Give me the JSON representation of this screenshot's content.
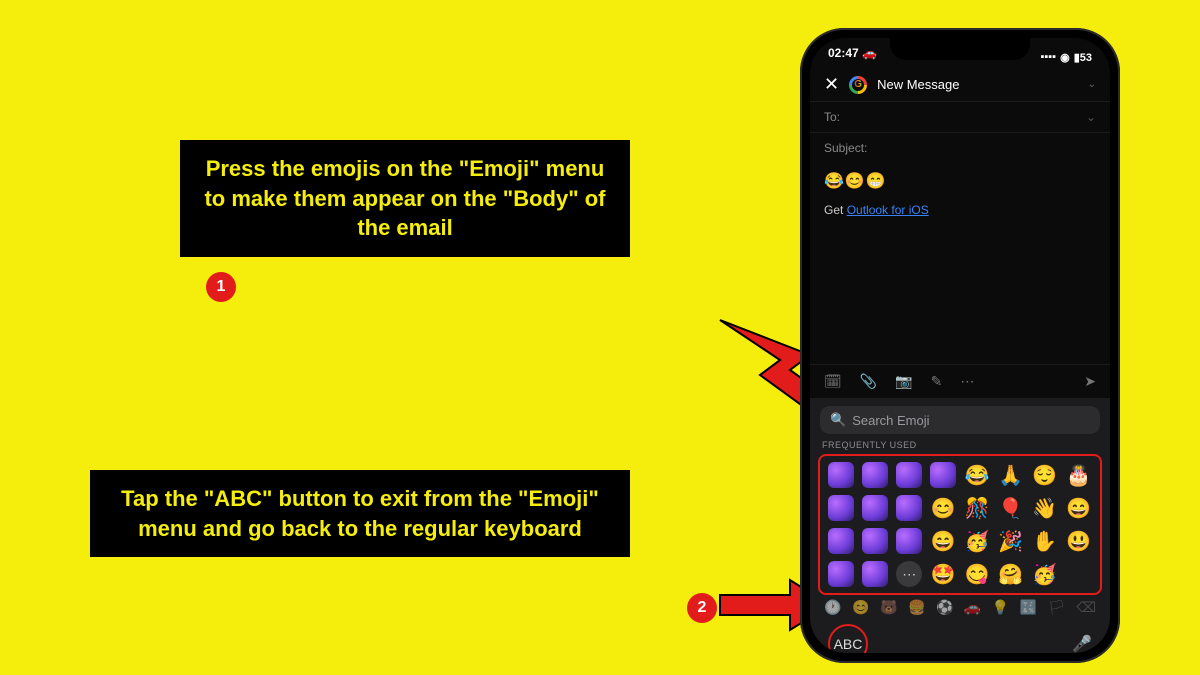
{
  "callouts": {
    "one": "Press the emojis on the \"Emoji\" menu to make them appear on the \"Body\" of the email",
    "two": "Tap the \"ABC\" button to exit from the \"Emoji\" menu and go back to the regular keyboard",
    "badge1": "1",
    "badge2": "2"
  },
  "status": {
    "time": "02:47",
    "car": "🚗",
    "battery": "53"
  },
  "header": {
    "title": "New Message",
    "close": "✕"
  },
  "fields": {
    "to_label": "To:",
    "subject_label": "Subject:"
  },
  "body": {
    "emojis": "😂😊😁",
    "sig_prefix": "Get ",
    "sig_link": "Outlook for iOS"
  },
  "keyboard": {
    "search_placeholder": "Search Emoji",
    "freq_label": "FREQUENTLY USED",
    "abc": "ABC",
    "emojis_row1": [
      "😂",
      "🙏",
      "😌",
      "🎂"
    ],
    "emojis_row2": [
      "😊",
      "🎊",
      "🎈",
      "👋",
      "😄"
    ],
    "emojis_row3": [
      "😄",
      "🥳",
      "🎉",
      "✋",
      "😃"
    ],
    "emojis_row4": [
      "🤩",
      "😋",
      "🤗",
      "🥳"
    ]
  }
}
